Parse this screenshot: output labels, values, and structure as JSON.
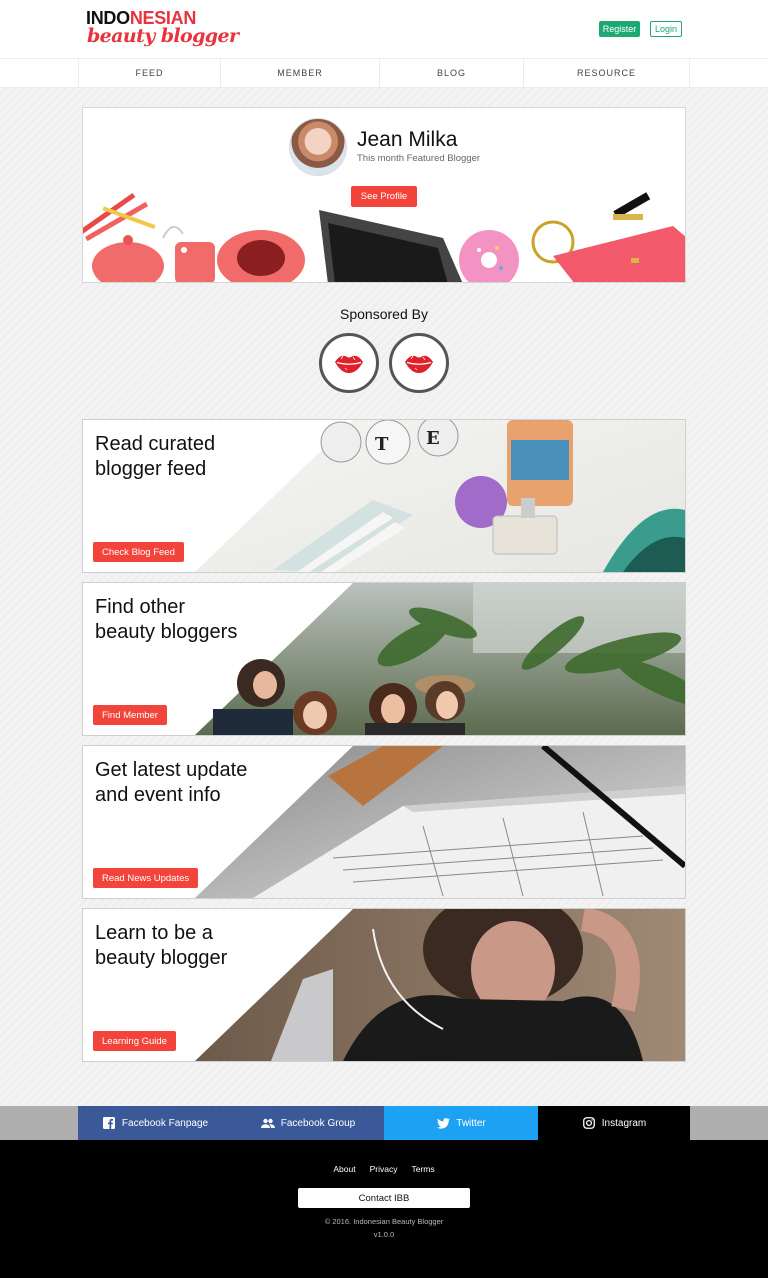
{
  "brand": {
    "line1_a": "INDO",
    "line1_b": "NESIAN",
    "line2": "beauty blogger"
  },
  "header": {
    "register_label": "Register",
    "login_label": "Login"
  },
  "nav": {
    "items": [
      "FEED",
      "MEMBER",
      "BLOG",
      "RESOURCE"
    ]
  },
  "featured": {
    "name": "Jean Milka",
    "subtitle": "This month Featured Blogger",
    "button_label": "See Profile"
  },
  "sponsors": {
    "title": "Sponsored By",
    "logos": [
      "lips-icon",
      "lips-icon"
    ]
  },
  "cards": [
    {
      "title": "Read curated\nblogger feed",
      "button": "Check Blog Feed"
    },
    {
      "title": "Find other\nbeauty bloggers",
      "button": "Find Member"
    },
    {
      "title": "Get latest update\nand event info",
      "button": "Read News Updates"
    },
    {
      "title": "Learn to be a\nbeauty blogger",
      "button": "Learning Guide"
    }
  ],
  "social": [
    {
      "label": "Facebook Fanpage",
      "icon": "facebook-icon",
      "color": "#3b5998"
    },
    {
      "label": "Facebook Group",
      "icon": "group-icon",
      "color": "#3b5998"
    },
    {
      "label": "Twitter",
      "icon": "twitter-icon",
      "color": "#1da1f2"
    },
    {
      "label": "Instagram",
      "icon": "instagram-icon",
      "color": "#000000"
    }
  ],
  "footer": {
    "links": [
      "About",
      "Privacy",
      "Terms"
    ],
    "contact_label": "Contact IBB",
    "copyright": "© 2016. Indonesian Beauty Blogger",
    "version": "v1.0.0"
  },
  "colors": {
    "accent_red": "#f2443b",
    "accent_green": "#1ea872"
  }
}
